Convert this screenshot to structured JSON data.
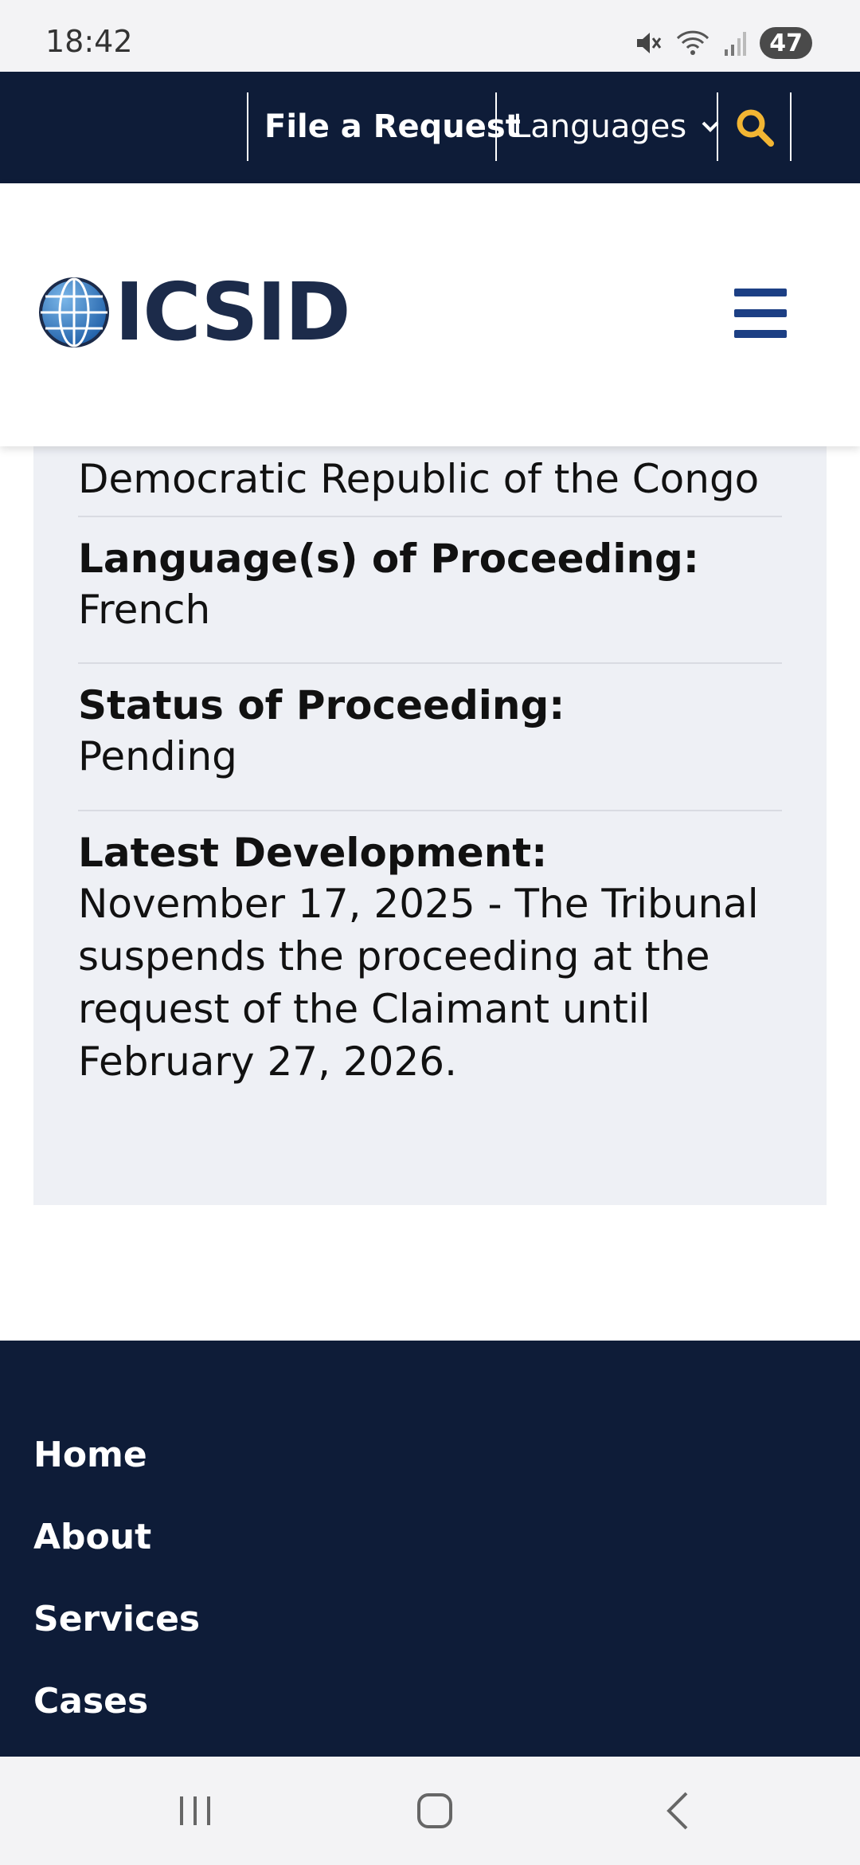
{
  "status_bar": {
    "time": "18:42",
    "battery": "47",
    "icons": [
      "mute-icon",
      "wifi-icon",
      "signal-icon"
    ]
  },
  "top_nav": {
    "file_request": "File a Request",
    "languages": "Languages",
    "search_icon": "search-icon",
    "accent_color": "#f2b533"
  },
  "header": {
    "logo_text": "ICSID",
    "menu_icon": "hamburger-menu-icon"
  },
  "case": {
    "respondent_value": "Democratic Republic of the Congo",
    "language_label": "Language(s) of Proceeding:",
    "language_value": "French",
    "status_label": "Status of Proceeding:",
    "status_value": "Pending",
    "development_label": "Latest Development:",
    "development_value": "November 17, 2025 - The Tribunal suspends the proceeding at the request of the Claimant until February 27, 2026."
  },
  "footer": {
    "links": [
      "Home",
      "About",
      "Services",
      "Cases"
    ]
  },
  "colors": {
    "navy": "#0e1c38",
    "card_bg": "#eef0f5",
    "menu_blue": "#1c3f84"
  }
}
